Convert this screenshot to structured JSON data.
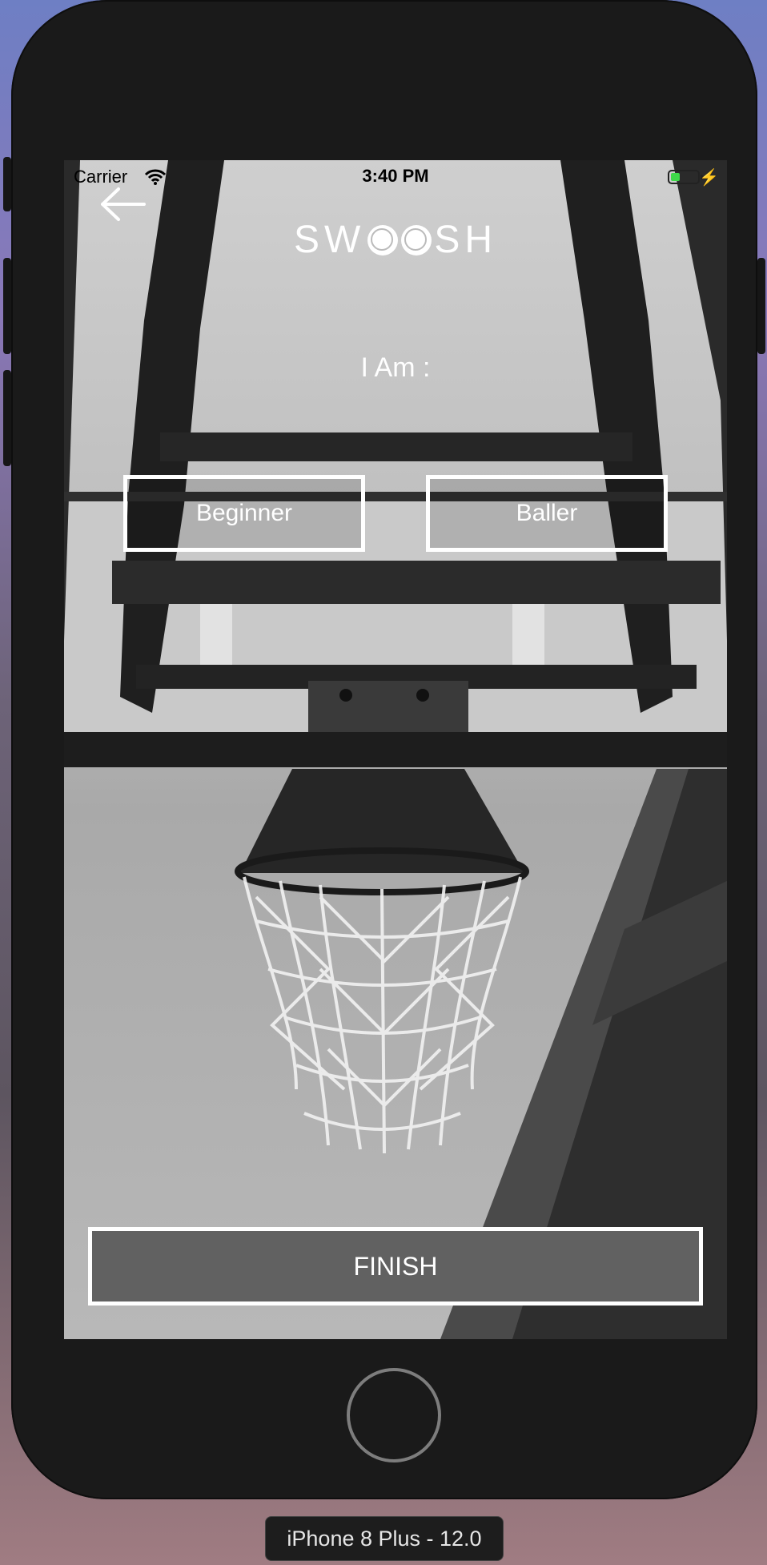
{
  "status_bar": {
    "carrier": "Carrier",
    "time": "3:40 PM",
    "battery_level": 0.35
  },
  "header": {
    "logo_left": "SW",
    "logo_right": "SH"
  },
  "prompt": "I Am :",
  "choices": {
    "beginner_label": "Beginner",
    "baller_label": "Baller"
  },
  "finish_label": "FINISH",
  "simulator": {
    "device_label": "iPhone 8 Plus - 12.0"
  },
  "colors": {
    "button_border": "#ffffff",
    "finish_fill": "#616161",
    "battery": "#3fd94a",
    "device_frame": "#1a1a1a"
  }
}
